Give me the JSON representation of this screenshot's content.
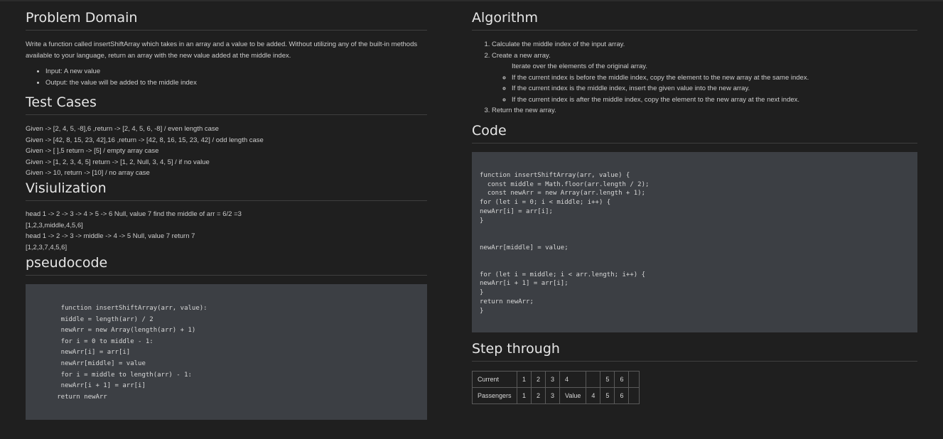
{
  "problem": {
    "heading": "Problem Domain",
    "description": "Write a function called insertShiftArray which takes in an array and a value to be added. Without utilizing any of the built-in methods available to your language, return an array with the new value added at the middle index.",
    "bullets": [
      "Input: A new value",
      "Output: the value will be added to the middle index"
    ]
  },
  "tests": {
    "heading": "Test Cases",
    "lines": [
      "Given -> [2, 4, 5, -8],6 ,return -> [2, 4, 5, 6, -8] / even length case",
      "Given -> [42, 8, 15, 23, 42],16 ,return -> [42, 8, 16, 15, 23, 42] / odd length case",
      "Given -> [ ],5 return -> [5] / empty array case",
      "Given -> [1, 2, 3, 4, 5] return -> [1, 2, Null, 3, 4, 5] / if no value",
      "Given -> 10, return -> [10] / no array case"
    ]
  },
  "visualization": {
    "heading": "Visiulization",
    "lines": [
      "head 1 -> 2 -> 3 -> 4 > 5 -> 6 Null, value 7 find the middle of arr = 6/2 =3",
      "[1,2,3,middle,4,5,6]",
      "head 1 -> 2 -> 3 -> middle -> 4 -> 5 Null, value 7 return 7",
      "[1,2,3,7,4,5,6]"
    ]
  },
  "pseudocode": {
    "heading": "pseudocode",
    "code": "    function insertShiftArray(arr, value):\n    middle = length(arr) / 2\n    newArr = new Array(length(arr) + 1)\n    for i = 0 to middle - 1:\n    newArr[i] = arr[i]\n    newArr[middle] = value\n    for i = middle to length(arr) - 1:\n    newArr[i + 1] = arr[i]\n   return newArr"
  },
  "algorithm": {
    "heading": "Algorithm",
    "steps": [
      "Calculate the middle index of the input array.",
      "Create a new array.",
      "Return the new array."
    ],
    "iterate_text": "Iterate over the elements of the original array.",
    "sub_steps": [
      "If the current index is before the middle index, copy the element to the new array at the same index.",
      "If the current index is the middle index, insert the given value into the new array.",
      "If the current index is after the middle index, copy the element to the new array at the next index."
    ]
  },
  "code": {
    "heading": "Code",
    "code": "function insertShiftArray(arr, value) {\n  const middle = Math.floor(arr.length / 2);\n  const newArr = new Array(arr.length + 1);\nfor (let i = 0; i < middle; i++) {\nnewArr[i] = arr[i];\n}\n\n\nnewArr[middle] = value;\n\n\nfor (let i = middle; i < arr.length; i++) {\nnewArr[i + 1] = arr[i];\n}\nreturn newArr;\n}"
  },
  "step_through": {
    "heading": "Step through",
    "rows": [
      [
        "Current",
        "1",
        "2",
        "3",
        "4",
        "",
        "5",
        "6",
        ""
      ],
      [
        "Passengers",
        "1",
        "2",
        "3",
        "Value",
        "4",
        "5",
        "6",
        ""
      ]
    ]
  }
}
